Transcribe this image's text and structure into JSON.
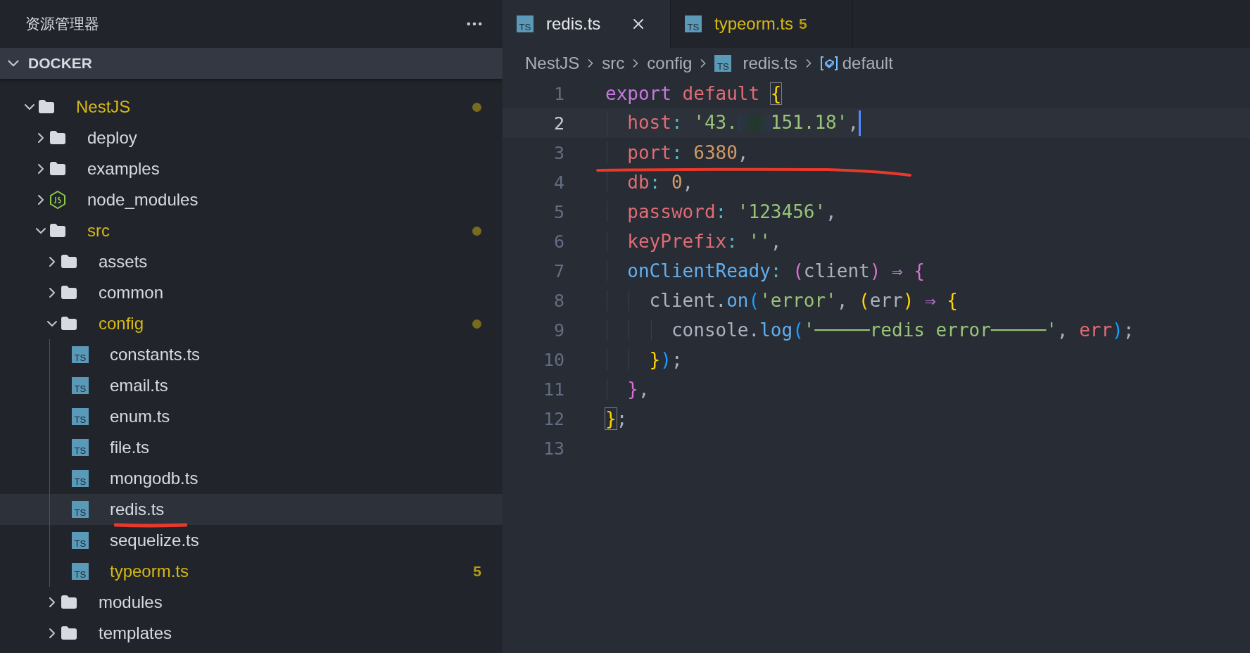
{
  "sidebar": {
    "title": "资源管理器",
    "section": "DOCKER",
    "tree": [
      {
        "label": "NestJS",
        "kind": "folder",
        "expanded": true,
        "modified": true,
        "selected": false,
        "children": [
          {
            "label": "deploy",
            "kind": "folder",
            "expanded": false,
            "modified": false,
            "selected": false
          },
          {
            "label": "examples",
            "kind": "folder",
            "expanded": false,
            "modified": false,
            "selected": false
          },
          {
            "label": "node_modules",
            "kind": "node",
            "expanded": false,
            "modified": false,
            "selected": false
          },
          {
            "label": "src",
            "kind": "folder",
            "expanded": true,
            "modified": true,
            "selected": false,
            "children": [
              {
                "label": "assets",
                "kind": "folder",
                "expanded": false,
                "modified": false,
                "selected": false
              },
              {
                "label": "common",
                "kind": "folder",
                "expanded": false,
                "modified": false,
                "selected": false
              },
              {
                "label": "config",
                "kind": "folder",
                "expanded": true,
                "modified": true,
                "selected": false,
                "children": [
                  {
                    "label": "constants.ts",
                    "kind": "ts",
                    "icon_label": "TS",
                    "modified": false,
                    "selected": false
                  },
                  {
                    "label": "email.ts",
                    "kind": "ts",
                    "icon_label": "TS",
                    "modified": false,
                    "selected": false
                  },
                  {
                    "label": "enum.ts",
                    "kind": "ts",
                    "icon_label": "TS",
                    "modified": false,
                    "selected": false
                  },
                  {
                    "label": "file.ts",
                    "kind": "ts",
                    "icon_label": "TS",
                    "modified": false,
                    "selected": false
                  },
                  {
                    "label": "mongodb.ts",
                    "kind": "ts",
                    "icon_label": "TS",
                    "modified": false,
                    "selected": false
                  },
                  {
                    "label": "redis.ts",
                    "kind": "ts",
                    "icon_label": "TS",
                    "modified": false,
                    "selected": true,
                    "underlined": true
                  },
                  {
                    "label": "sequelize.ts",
                    "kind": "ts",
                    "icon_label": "TS",
                    "modified": false,
                    "selected": false
                  },
                  {
                    "label": "typeorm.ts",
                    "kind": "ts",
                    "icon_label": "TS",
                    "modified": false,
                    "selected": false,
                    "badge": "5"
                  }
                ]
              },
              {
                "label": "modules",
                "kind": "folder",
                "expanded": false,
                "modified": false,
                "selected": false
              },
              {
                "label": "templates",
                "kind": "folder",
                "expanded": false,
                "modified": false,
                "selected": false
              }
            ]
          }
        ]
      }
    ]
  },
  "tabs": [
    {
      "label": "redis.ts",
      "icon_label": "TS",
      "selected": true
    },
    {
      "label": "typeorm.ts",
      "icon_label": "TS",
      "selected": false,
      "badge": "5"
    }
  ],
  "breadcrumb": [
    {
      "label": "NestJS",
      "kind": "folder"
    },
    {
      "label": "src",
      "kind": "folder"
    },
    {
      "label": "config",
      "kind": "folder"
    },
    {
      "label": "redis.ts",
      "kind": "file",
      "icon_label": "TS"
    },
    {
      "label": "default",
      "kind": "symbol"
    }
  ],
  "code": [
    {
      "number": "1",
      "current": false,
      "tokens": [
        {
          "text": "export ",
          "kind": "keyword"
        },
        {
          "text": "default ",
          "kind": "property"
        },
        {
          "text": "{",
          "kind": "bracket1",
          "matched": true
        }
      ]
    },
    {
      "number": "2",
      "current": true,
      "tokens": [
        {
          "text": "  host",
          "kind": "property"
        },
        {
          "text": ": ",
          "kind": "punct"
        },
        {
          "text": "'43.",
          "kind": "string"
        },
        {
          "kind": "redacted"
        },
        {
          "text": "151.18'",
          "kind": "string"
        },
        {
          "text": ",",
          "kind": "plain"
        }
      ]
    },
    {
      "number": "3",
      "current": false,
      "underlined": true,
      "tokens": [
        {
          "text": "  port",
          "kind": "property"
        },
        {
          "text": ": ",
          "kind": "punct"
        },
        {
          "text": "6380",
          "kind": "number"
        },
        {
          "text": ",",
          "kind": "plain"
        }
      ]
    },
    {
      "number": "4",
      "current": false,
      "tokens": [
        {
          "text": "  db",
          "kind": "property"
        },
        {
          "text": ": ",
          "kind": "punct"
        },
        {
          "text": "0",
          "kind": "number"
        },
        {
          "text": ",",
          "kind": "plain"
        }
      ]
    },
    {
      "number": "5",
      "current": false,
      "tokens": [
        {
          "text": "  password",
          "kind": "property"
        },
        {
          "text": ": ",
          "kind": "punct"
        },
        {
          "text": "'123456'",
          "kind": "string"
        },
        {
          "text": ",",
          "kind": "plain"
        }
      ]
    },
    {
      "number": "6",
      "current": false,
      "tokens": [
        {
          "text": "  keyPrefix",
          "kind": "property"
        },
        {
          "text": ": ",
          "kind": "punct"
        },
        {
          "text": "''",
          "kind": "string"
        },
        {
          "text": ",",
          "kind": "plain"
        }
      ]
    },
    {
      "number": "7",
      "current": false,
      "tokens": [
        {
          "text": "  onClientReady",
          "kind": "function"
        },
        {
          "text": ": ",
          "kind": "punct"
        },
        {
          "text": "(",
          "kind": "bracket2"
        },
        {
          "text": "client",
          "kind": "plain"
        },
        {
          "text": ") ",
          "kind": "bracket2"
        },
        {
          "text": "⇒ ",
          "kind": "keyword"
        },
        {
          "text": "{",
          "kind": "bracket2"
        }
      ]
    },
    {
      "number": "8",
      "current": false,
      "tokens": [
        {
          "text": "    client.",
          "kind": "plain"
        },
        {
          "text": "on",
          "kind": "function"
        },
        {
          "text": "(",
          "kind": "bracket3"
        },
        {
          "text": "'error'",
          "kind": "string"
        },
        {
          "text": ", ",
          "kind": "plain"
        },
        {
          "text": "(",
          "kind": "bracket1"
        },
        {
          "text": "err",
          "kind": "plain"
        },
        {
          "text": ") ",
          "kind": "bracket1"
        },
        {
          "text": "⇒ ",
          "kind": "keyword"
        },
        {
          "text": "{",
          "kind": "bracket1"
        }
      ]
    },
    {
      "number": "9",
      "current": false,
      "tokens": [
        {
          "text": "      console.",
          "kind": "plain"
        },
        {
          "text": "log",
          "kind": "function"
        },
        {
          "text": "(",
          "kind": "bracket3"
        },
        {
          "text": "'─────redis error─────'",
          "kind": "string"
        },
        {
          "text": ", ",
          "kind": "plain"
        },
        {
          "text": "err",
          "kind": "property"
        },
        {
          "text": ")",
          "kind": "bracket3"
        },
        {
          "text": ";",
          "kind": "plain"
        }
      ]
    },
    {
      "number": "10",
      "current": false,
      "tokens": [
        {
          "text": "    }",
          "kind": "bracket1"
        },
        {
          "text": ")",
          "kind": "bracket3"
        },
        {
          "text": ";",
          "kind": "plain"
        }
      ]
    },
    {
      "number": "11",
      "current": false,
      "tokens": [
        {
          "text": "  }",
          "kind": "bracket2"
        },
        {
          "text": ",",
          "kind": "plain"
        }
      ]
    },
    {
      "number": "12",
      "current": false,
      "tokens": [
        {
          "text": "}",
          "kind": "bracket1",
          "matched": true
        },
        {
          "text": ";",
          "kind": "plain"
        }
      ]
    },
    {
      "number": "13",
      "current": false
    }
  ]
}
